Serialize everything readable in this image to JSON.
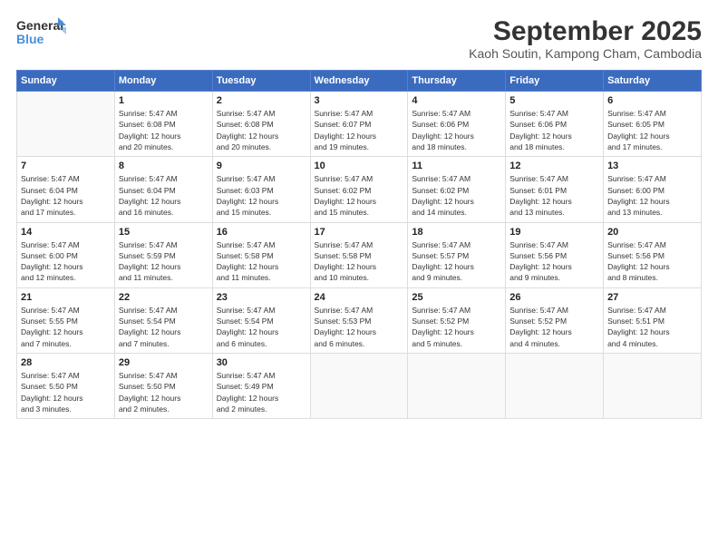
{
  "header": {
    "logo_line1": "General",
    "logo_line2": "Blue",
    "month": "September 2025",
    "location": "Kaoh Soutin, Kampong Cham, Cambodia"
  },
  "weekdays": [
    "Sunday",
    "Monday",
    "Tuesday",
    "Wednesday",
    "Thursday",
    "Friday",
    "Saturday"
  ],
  "weeks": [
    [
      {
        "day": "",
        "info": ""
      },
      {
        "day": "1",
        "info": "Sunrise: 5:47 AM\nSunset: 6:08 PM\nDaylight: 12 hours\nand 20 minutes."
      },
      {
        "day": "2",
        "info": "Sunrise: 5:47 AM\nSunset: 6:08 PM\nDaylight: 12 hours\nand 20 minutes."
      },
      {
        "day": "3",
        "info": "Sunrise: 5:47 AM\nSunset: 6:07 PM\nDaylight: 12 hours\nand 19 minutes."
      },
      {
        "day": "4",
        "info": "Sunrise: 5:47 AM\nSunset: 6:06 PM\nDaylight: 12 hours\nand 18 minutes."
      },
      {
        "day": "5",
        "info": "Sunrise: 5:47 AM\nSunset: 6:06 PM\nDaylight: 12 hours\nand 18 minutes."
      },
      {
        "day": "6",
        "info": "Sunrise: 5:47 AM\nSunset: 6:05 PM\nDaylight: 12 hours\nand 17 minutes."
      }
    ],
    [
      {
        "day": "7",
        "info": "Sunrise: 5:47 AM\nSunset: 6:04 PM\nDaylight: 12 hours\nand 17 minutes."
      },
      {
        "day": "8",
        "info": "Sunrise: 5:47 AM\nSunset: 6:04 PM\nDaylight: 12 hours\nand 16 minutes."
      },
      {
        "day": "9",
        "info": "Sunrise: 5:47 AM\nSunset: 6:03 PM\nDaylight: 12 hours\nand 15 minutes."
      },
      {
        "day": "10",
        "info": "Sunrise: 5:47 AM\nSunset: 6:02 PM\nDaylight: 12 hours\nand 15 minutes."
      },
      {
        "day": "11",
        "info": "Sunrise: 5:47 AM\nSunset: 6:02 PM\nDaylight: 12 hours\nand 14 minutes."
      },
      {
        "day": "12",
        "info": "Sunrise: 5:47 AM\nSunset: 6:01 PM\nDaylight: 12 hours\nand 13 minutes."
      },
      {
        "day": "13",
        "info": "Sunrise: 5:47 AM\nSunset: 6:00 PM\nDaylight: 12 hours\nand 13 minutes."
      }
    ],
    [
      {
        "day": "14",
        "info": "Sunrise: 5:47 AM\nSunset: 6:00 PM\nDaylight: 12 hours\nand 12 minutes."
      },
      {
        "day": "15",
        "info": "Sunrise: 5:47 AM\nSunset: 5:59 PM\nDaylight: 12 hours\nand 11 minutes."
      },
      {
        "day": "16",
        "info": "Sunrise: 5:47 AM\nSunset: 5:58 PM\nDaylight: 12 hours\nand 11 minutes."
      },
      {
        "day": "17",
        "info": "Sunrise: 5:47 AM\nSunset: 5:58 PM\nDaylight: 12 hours\nand 10 minutes."
      },
      {
        "day": "18",
        "info": "Sunrise: 5:47 AM\nSunset: 5:57 PM\nDaylight: 12 hours\nand 9 minutes."
      },
      {
        "day": "19",
        "info": "Sunrise: 5:47 AM\nSunset: 5:56 PM\nDaylight: 12 hours\nand 9 minutes."
      },
      {
        "day": "20",
        "info": "Sunrise: 5:47 AM\nSunset: 5:56 PM\nDaylight: 12 hours\nand 8 minutes."
      }
    ],
    [
      {
        "day": "21",
        "info": "Sunrise: 5:47 AM\nSunset: 5:55 PM\nDaylight: 12 hours\nand 7 minutes."
      },
      {
        "day": "22",
        "info": "Sunrise: 5:47 AM\nSunset: 5:54 PM\nDaylight: 12 hours\nand 7 minutes."
      },
      {
        "day": "23",
        "info": "Sunrise: 5:47 AM\nSunset: 5:54 PM\nDaylight: 12 hours\nand 6 minutes."
      },
      {
        "day": "24",
        "info": "Sunrise: 5:47 AM\nSunset: 5:53 PM\nDaylight: 12 hours\nand 6 minutes."
      },
      {
        "day": "25",
        "info": "Sunrise: 5:47 AM\nSunset: 5:52 PM\nDaylight: 12 hours\nand 5 minutes."
      },
      {
        "day": "26",
        "info": "Sunrise: 5:47 AM\nSunset: 5:52 PM\nDaylight: 12 hours\nand 4 minutes."
      },
      {
        "day": "27",
        "info": "Sunrise: 5:47 AM\nSunset: 5:51 PM\nDaylight: 12 hours\nand 4 minutes."
      }
    ],
    [
      {
        "day": "28",
        "info": "Sunrise: 5:47 AM\nSunset: 5:50 PM\nDaylight: 12 hours\nand 3 minutes."
      },
      {
        "day": "29",
        "info": "Sunrise: 5:47 AM\nSunset: 5:50 PM\nDaylight: 12 hours\nand 2 minutes."
      },
      {
        "day": "30",
        "info": "Sunrise: 5:47 AM\nSunset: 5:49 PM\nDaylight: 12 hours\nand 2 minutes."
      },
      {
        "day": "",
        "info": ""
      },
      {
        "day": "",
        "info": ""
      },
      {
        "day": "",
        "info": ""
      },
      {
        "day": "",
        "info": ""
      }
    ]
  ]
}
